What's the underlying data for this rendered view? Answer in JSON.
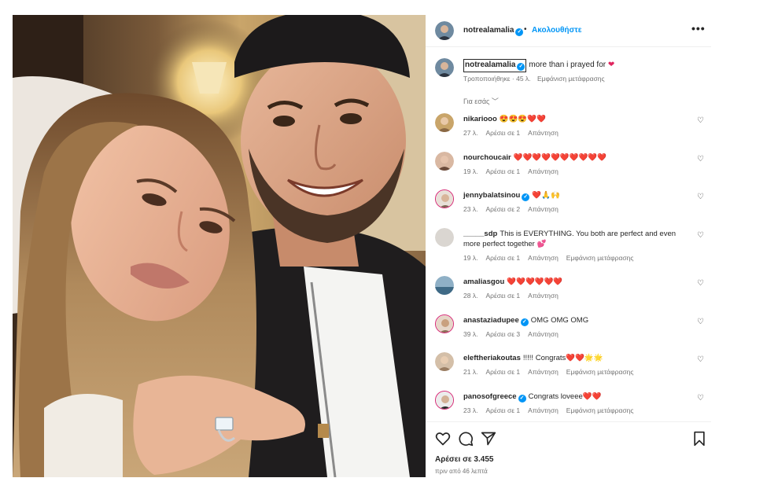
{
  "post": {
    "username": "notrealamalia",
    "dot": "•",
    "follow_label": "Ακολουθήστε",
    "more_label": "•••"
  },
  "caption": {
    "username": "notrealamalia",
    "text": "more than i prayed for",
    "edited": "Τροποποιήθηκε · 45 λ.",
    "translate": "Εμφάνιση μετάφρασης"
  },
  "for_you_label": "Για εσάς",
  "comments": [
    {
      "user": "nikariooo",
      "verified": false,
      "text": "😍😍😍❤️❤️",
      "time": "27 λ.",
      "likes": "Αρέσει σε 1",
      "reply": "Απάντηση",
      "translate": ""
    },
    {
      "user": "nourchoucair",
      "verified": false,
      "text": "❤️❤️❤️❤️❤️❤️❤️❤️❤️❤️",
      "time": "19 λ.",
      "likes": "Αρέσει σε 1",
      "reply": "Απάντηση",
      "translate": ""
    },
    {
      "user": "jennybalatsinou",
      "verified": true,
      "text": "❤️🙏🙌",
      "time": "23 λ.",
      "likes": "Αρέσει σε 2",
      "reply": "Απάντηση",
      "translate": ""
    },
    {
      "user": "_____sdp",
      "verified": false,
      "text": "This is EVERYTHING. You both are perfect and even more perfect together 💕",
      "time": "19 λ.",
      "likes": "Αρέσει σε 1",
      "reply": "Απάντηση",
      "translate": "Εμφάνιση μετάφρασης"
    },
    {
      "user": "amaliasgou",
      "verified": false,
      "text": "❤️❤️❤️❤️❤️❤️",
      "time": "28 λ.",
      "likes": "Αρέσει σε 1",
      "reply": "Απάντηση",
      "translate": ""
    },
    {
      "user": "anastaziadupee",
      "verified": true,
      "text": "OMG OMG OMG",
      "time": "39 λ.",
      "likes": "Αρέσει σε 3",
      "reply": "Απάντηση",
      "translate": ""
    },
    {
      "user": "eleftheriakoutas",
      "verified": false,
      "text": "!!!!! Congrats❤️❤️🌟🌟",
      "time": "21 λ.",
      "likes": "Αρέσει σε 1",
      "reply": "Απάντηση",
      "translate": "Εμφάνιση μετάφρασης"
    },
    {
      "user": "panosofgreece",
      "verified": true,
      "text": "Congrats loveee❤️❤️",
      "time": "23 λ.",
      "likes": "Αρέσει σε 1",
      "reply": "Απάντηση",
      "translate": "Εμφάνιση μετάφρασης"
    }
  ],
  "footer": {
    "likes": "Αρέσει σε 3.455",
    "time": "πριν από 46 λεπτά"
  },
  "icons": {
    "like": "heart-outline-icon",
    "comment": "speech-bubble-icon",
    "share": "paper-plane-icon",
    "save": "bookmark-icon",
    "comment_like": "small-heart-icon",
    "verified": "verified-badge-icon",
    "more": "more-options-icon",
    "chevron": "chevron-down-icon"
  },
  "colors": {
    "accent": "#0095f6",
    "text": "#262626",
    "muted": "#737373",
    "heart": "#e0245e"
  }
}
